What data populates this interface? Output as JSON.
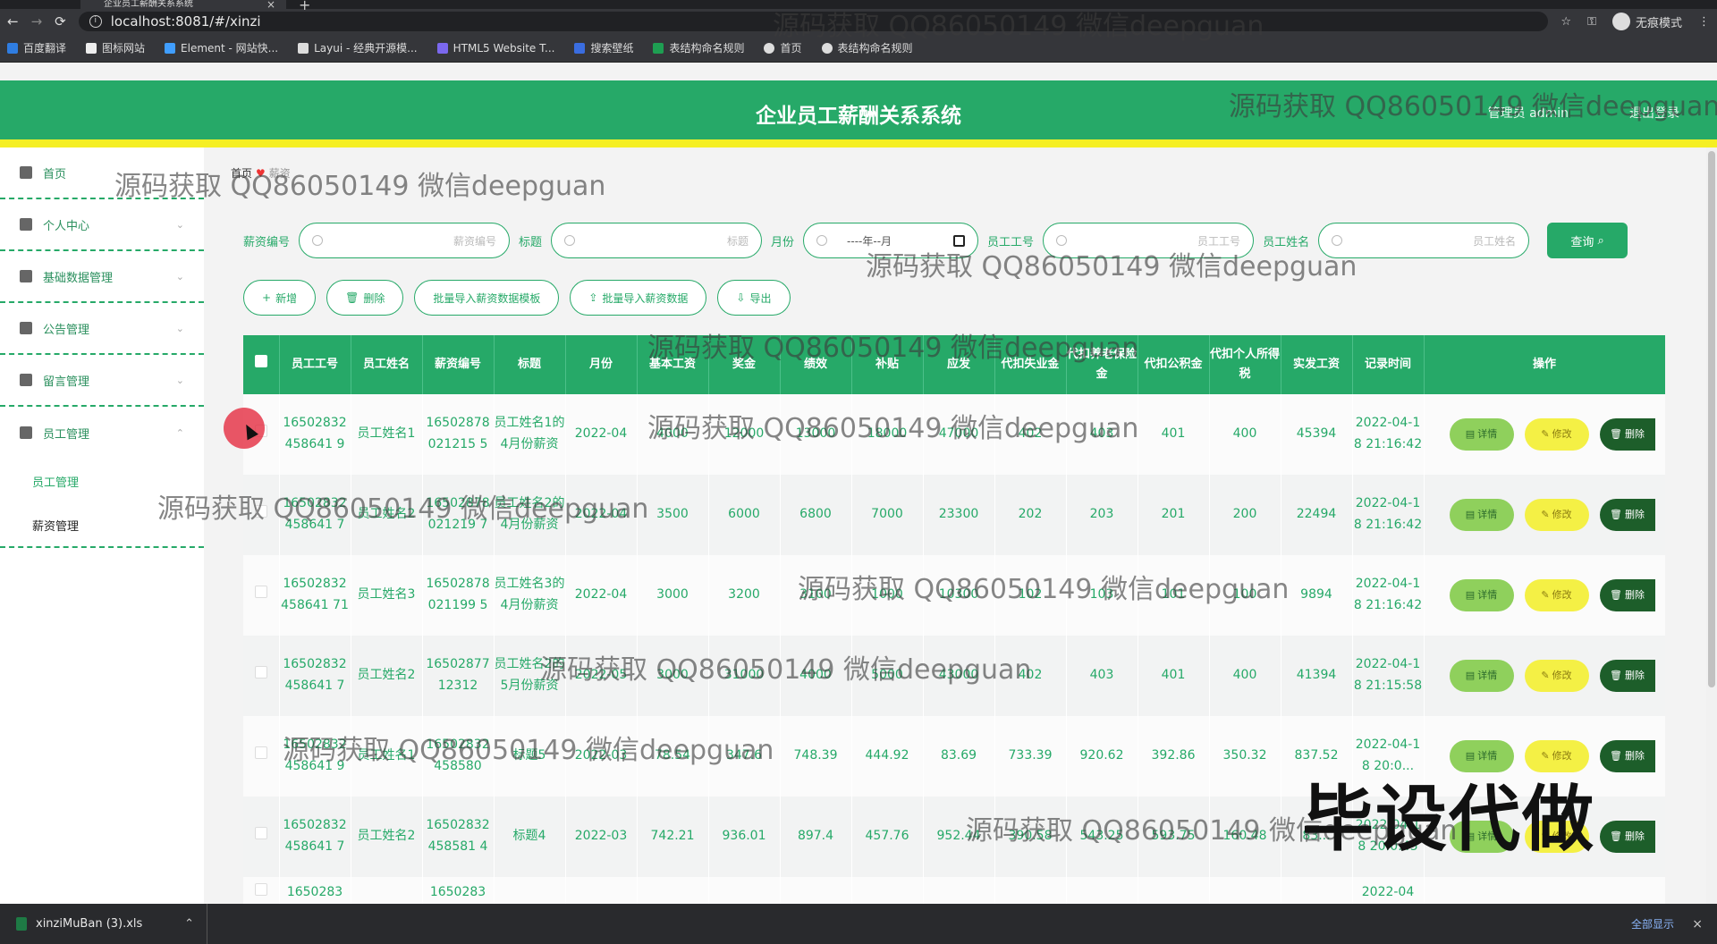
{
  "browser": {
    "tab_title": "企业员工薪酬关系系统",
    "url": "localhost:8081/#/xinzi",
    "incognito_label": "无痕模式",
    "bookmarks": [
      "百度翻译",
      "图标网站",
      "Element - 网站快...",
      "Layui - 经典开源模...",
      "HTML5 Website T...",
      "搜索壁纸",
      "表结构命名规则",
      "首页",
      "表结构命名规则"
    ]
  },
  "header": {
    "title": "企业员工薪酬关系系统",
    "user": "管理员 admin",
    "logout": "退出登录"
  },
  "sidebar": {
    "items": [
      {
        "label": "首页"
      },
      {
        "label": "个人中心"
      },
      {
        "label": "基础数据管理"
      },
      {
        "label": "公告管理"
      },
      {
        "label": "留言管理"
      },
      {
        "label": "员工管理"
      }
    ],
    "sub_items": [
      {
        "label": "员工管理"
      },
      {
        "label": "薪资管理"
      }
    ]
  },
  "breadcrumb": {
    "home": "首页",
    "current": "薪资"
  },
  "search": {
    "salary_no_label": "薪资编号",
    "salary_no_ph": "薪资编号",
    "title_label": "标题",
    "title_ph": "标题",
    "month_label": "月份",
    "month_ph": "----年--月",
    "emp_no_label": "员工工号",
    "emp_no_ph": "员工工号",
    "emp_name_label": "员工姓名",
    "emp_name_ph": "员工姓名",
    "query_btn": "查询"
  },
  "actions": {
    "add": "新增",
    "delete": "删除",
    "template": "批量导入薪资数据模板",
    "import": "批量导入薪资数据",
    "export": "导出"
  },
  "table": {
    "headers": [
      "员工工号",
      "员工姓名",
      "薪资编号",
      "标题",
      "月份",
      "基本工资",
      "奖金",
      "绩效",
      "补贴",
      "应发",
      "代扣失业金",
      "代扣养老保险金",
      "代扣公积金",
      "代扣个人所得税",
      "实发工资",
      "记录时间",
      "操作"
    ],
    "op_labels": {
      "detail": "详情",
      "edit": "修改",
      "delete": "删除"
    },
    "rows": [
      {
        "emp_no": "16502832458641 9",
        "name": "员工姓名1",
        "salary_no": "16502878021215 5",
        "title": "员工姓名1的4月份薪资",
        "month": "2022-04",
        "base": "4000",
        "bonus": "12000",
        "perf": "13000",
        "allow": "18000",
        "gross": "47000",
        "unemp": "402",
        "pension": "403",
        "fund": "401",
        "tax": "400",
        "net": "45394",
        "time": "2022-04-18 21:16:42"
      },
      {
        "emp_no": "16502832458641 7",
        "name": "员工姓名2",
        "salary_no": "16502878021219 7",
        "title": "员工姓名2的4月份薪资",
        "month": "2022-04",
        "base": "3500",
        "bonus": "6000",
        "perf": "6800",
        "allow": "7000",
        "gross": "23300",
        "unemp": "202",
        "pension": "203",
        "fund": "201",
        "tax": "200",
        "net": "22494",
        "time": "2022-04-18 21:16:42"
      },
      {
        "emp_no": "16502832458641 71",
        "name": "员工姓名3",
        "salary_no": "16502878021199 5",
        "title": "员工姓名3的4月份薪资",
        "month": "2022-04",
        "base": "3000",
        "bonus": "3200",
        "perf": "3100",
        "allow": "1000",
        "gross": "10300",
        "unemp": "102",
        "pension": "103",
        "fund": "101",
        "tax": "100",
        "net": "9894",
        "time": "2022-04-18 21:16:42"
      },
      {
        "emp_no": "16502832458641 7",
        "name": "员工姓名2",
        "salary_no": "1650287712312",
        "title": "员工姓名2的5月份薪资",
        "month": "2022-05",
        "base": "3000",
        "bonus": "31000",
        "perf": "4000",
        "allow": "5000",
        "gross": "43000",
        "unemp": "402",
        "pension": "403",
        "fund": "401",
        "tax": "400",
        "net": "41394",
        "time": "2022-04-18 21:15:58"
      },
      {
        "emp_no": "16502832458641 9",
        "name": "员工姓名1",
        "salary_no": "16502832458580",
        "title": "标题5",
        "month": "2022-03",
        "base": "78.54",
        "bonus": "347.6",
        "perf": "748.39",
        "allow": "444.92",
        "gross": "83.69",
        "unemp": "733.39",
        "pension": "920.62",
        "fund": "392.86",
        "tax": "350.32",
        "net": "837.52",
        "time": "2022-04-18 20:0..."
      },
      {
        "emp_no": "16502832458641 7",
        "name": "员工姓名2",
        "salary_no": "16502832458581 4",
        "title": "标题4",
        "month": "2022-03",
        "base": "742.21",
        "bonus": "936.01",
        "perf": "897.4",
        "allow": "457.76",
        "gross": "952.44",
        "unemp": "390.58",
        "pension": "543.25",
        "fund": "593.75",
        "tax": "160.48",
        "net": "83...",
        "time": "2022-04-18 20:0:45"
      },
      {
        "emp_no": "1650283",
        "name": "",
        "salary_no": "1650283",
        "title": "",
        "month": "",
        "base": "",
        "bonus": "",
        "perf": "",
        "allow": "",
        "gross": "",
        "unemp": "",
        "pension": "",
        "fund": "",
        "tax": "",
        "net": "",
        "time": "2022-04"
      }
    ]
  },
  "download_bar": {
    "file": "xinziMuBan (3).xls",
    "show_all": "全部显示"
  },
  "overlay": {
    "watermark": "源码获取 QQ86050149 微信deepguan",
    "badge": "毕设代做"
  },
  "colors": {
    "primary": "#26a968",
    "accent_yellow": "#f5ef24",
    "delete_dark": "#1d5e2a"
  }
}
